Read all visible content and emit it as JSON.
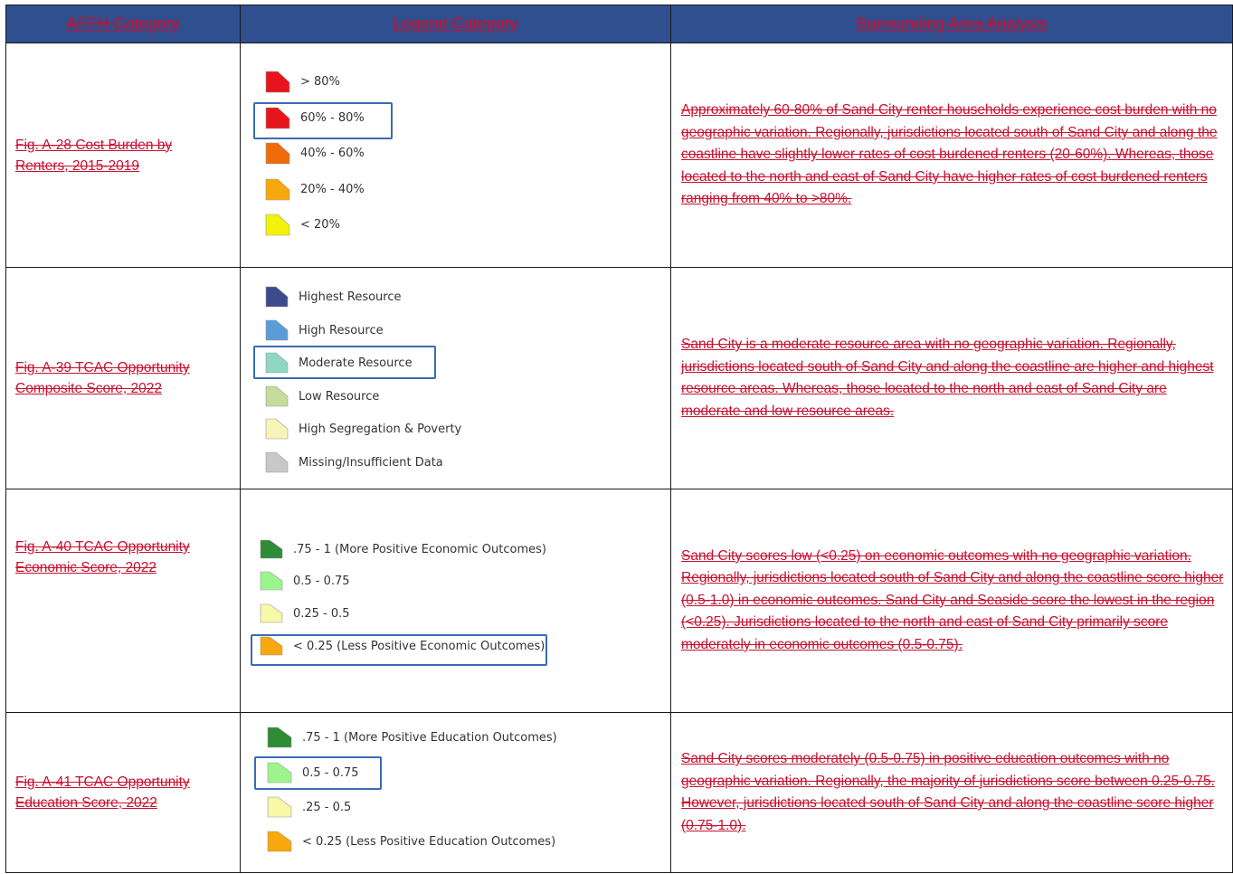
{
  "table": {
    "headers": [
      "AFFH Category",
      "Legend Category",
      "Surrounding Area Analysis"
    ],
    "rows": [
      {
        "category": "Fig. A-28 Cost Burden by Renters, 2015-2019",
        "legend": [
          {
            "label": "> 80%",
            "color": "#e8141c"
          },
          {
            "label": "60% - 80%",
            "color": "#e8141c"
          },
          {
            "label": "40% - 60%",
            "color": "#f06b0a"
          },
          {
            "label": "20% - 40%",
            "color": "#f7a80c"
          },
          {
            "label": "< 20%",
            "color": "#f2f20a"
          }
        ],
        "highlighted": "60% - 80%",
        "analysis": "Approximately 60-80% of Sand City renter households experience cost burden with no geographic variation. Regionally, jurisdictions located south of Sand City and along the coastline have slightly lower rates of cost burdened renters (20-60%). Whereas, those located to the north and east of Sand City have higher rates of cost burdened renters ranging from 40% to >80%."
      },
      {
        "category": "Fig. A-39 TCAC Opportunity Composite Score, 2022",
        "legend": [
          {
            "label": "Highest Resource",
            "color": "#3d4b8c"
          },
          {
            "label": "High Resource",
            "color": "#5b9bd8"
          },
          {
            "label": "Moderate Resource",
            "color": "#8fd6c4"
          },
          {
            "label": "Low Resource",
            "color": "#c4dc9c"
          },
          {
            "label": "High Segregation & Poverty",
            "color": "#f7f4b8"
          },
          {
            "label": "Missing/Insufficient Data",
            "color": "#c8c8c8"
          }
        ],
        "highlighted": "Moderate Resource",
        "analysis": "Sand City is a moderate resource area with no geographic variation. Regionally, jurisdictions located south of Sand City and along the coastline are higher and highest resource areas. Whereas, those located to the north and east of Sand City are moderate and low resource areas."
      },
      {
        "category": "Fig. A-40 TCAC Opportunity Economic Score, 2022",
        "legend": [
          {
            "label": ".75 - 1 (More Positive Economic Outcomes)",
            "color": "#2d8c35"
          },
          {
            "label": "0.5 - 0.75",
            "color": "#9cf58c"
          },
          {
            "label": "0.25 - 0.5",
            "color": "#f9f7a8"
          },
          {
            "label": "< 0.25 (Less Positive Economic Outcomes)",
            "color": "#f7a80c"
          }
        ],
        "highlighted": "< 0.25 (Less Positive Economic Outcomes)",
        "analysis": "Sand City scores low (<0.25) on economic outcomes with no geographic variation. Regionally, jurisdictions located south of Sand City and along the coastline score higher (0.5-1.0) in economic outcomes. Sand City and Seaside score the lowest in the region (<0.25). Jurisdictions located to the north and east of Sand City primarily score moderately in economic outcomes (0.5-0.75)."
      },
      {
        "category": "Fig. A-41 TCAC Opportunity Education Score, 2022",
        "legend": [
          {
            "label": ".75 - 1 (More Positive Education Outcomes)",
            "color": "#2d8c35"
          },
          {
            "label": "0.5 - 0.75",
            "color": "#9cf58c"
          },
          {
            "label": ".25 - 0.5",
            "color": "#f9f7a8"
          },
          {
            "label": "< 0.25 (Less Positive Education Outcomes)",
            "color": "#f7a80c"
          }
        ],
        "highlighted": "0.5 - 0.75",
        "analysis": "Sand City scores moderately (0.5-0.75) in positive education outcomes with no geographic variation. Regionally, the majority of jurisdictions score between 0.25-0.75. However, jurisdictions located south of Sand City and along the coastline score higher (0.75-1.0)."
      }
    ]
  }
}
